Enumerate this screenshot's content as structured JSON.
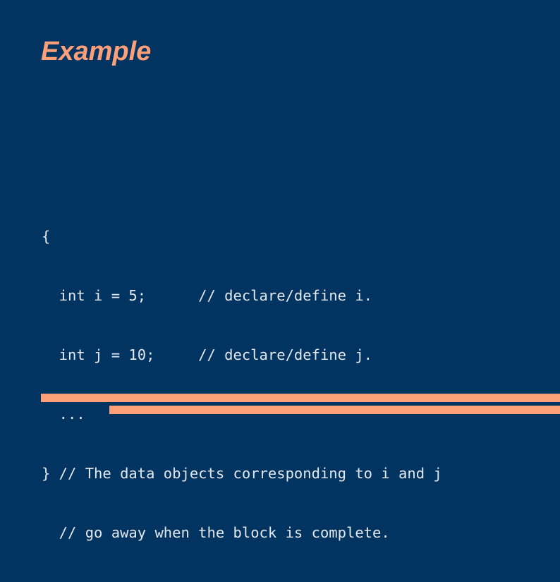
{
  "slide": {
    "title": "Example",
    "background_color": "#023462",
    "accent_color": "#fda07a",
    "code_color": "#e2e8ee"
  },
  "code": {
    "lines": [
      "{",
      "  int i = 5;      // declare/define i.",
      "  int j = 10;     // declare/define j.",
      "  ...",
      "} // The data objects corresponding to i and j",
      "  // go away when the block is complete."
    ]
  },
  "decor": {
    "bar_top_label": "accent-bar-upper",
    "bar_bottom_label": "accent-bar-lower"
  }
}
